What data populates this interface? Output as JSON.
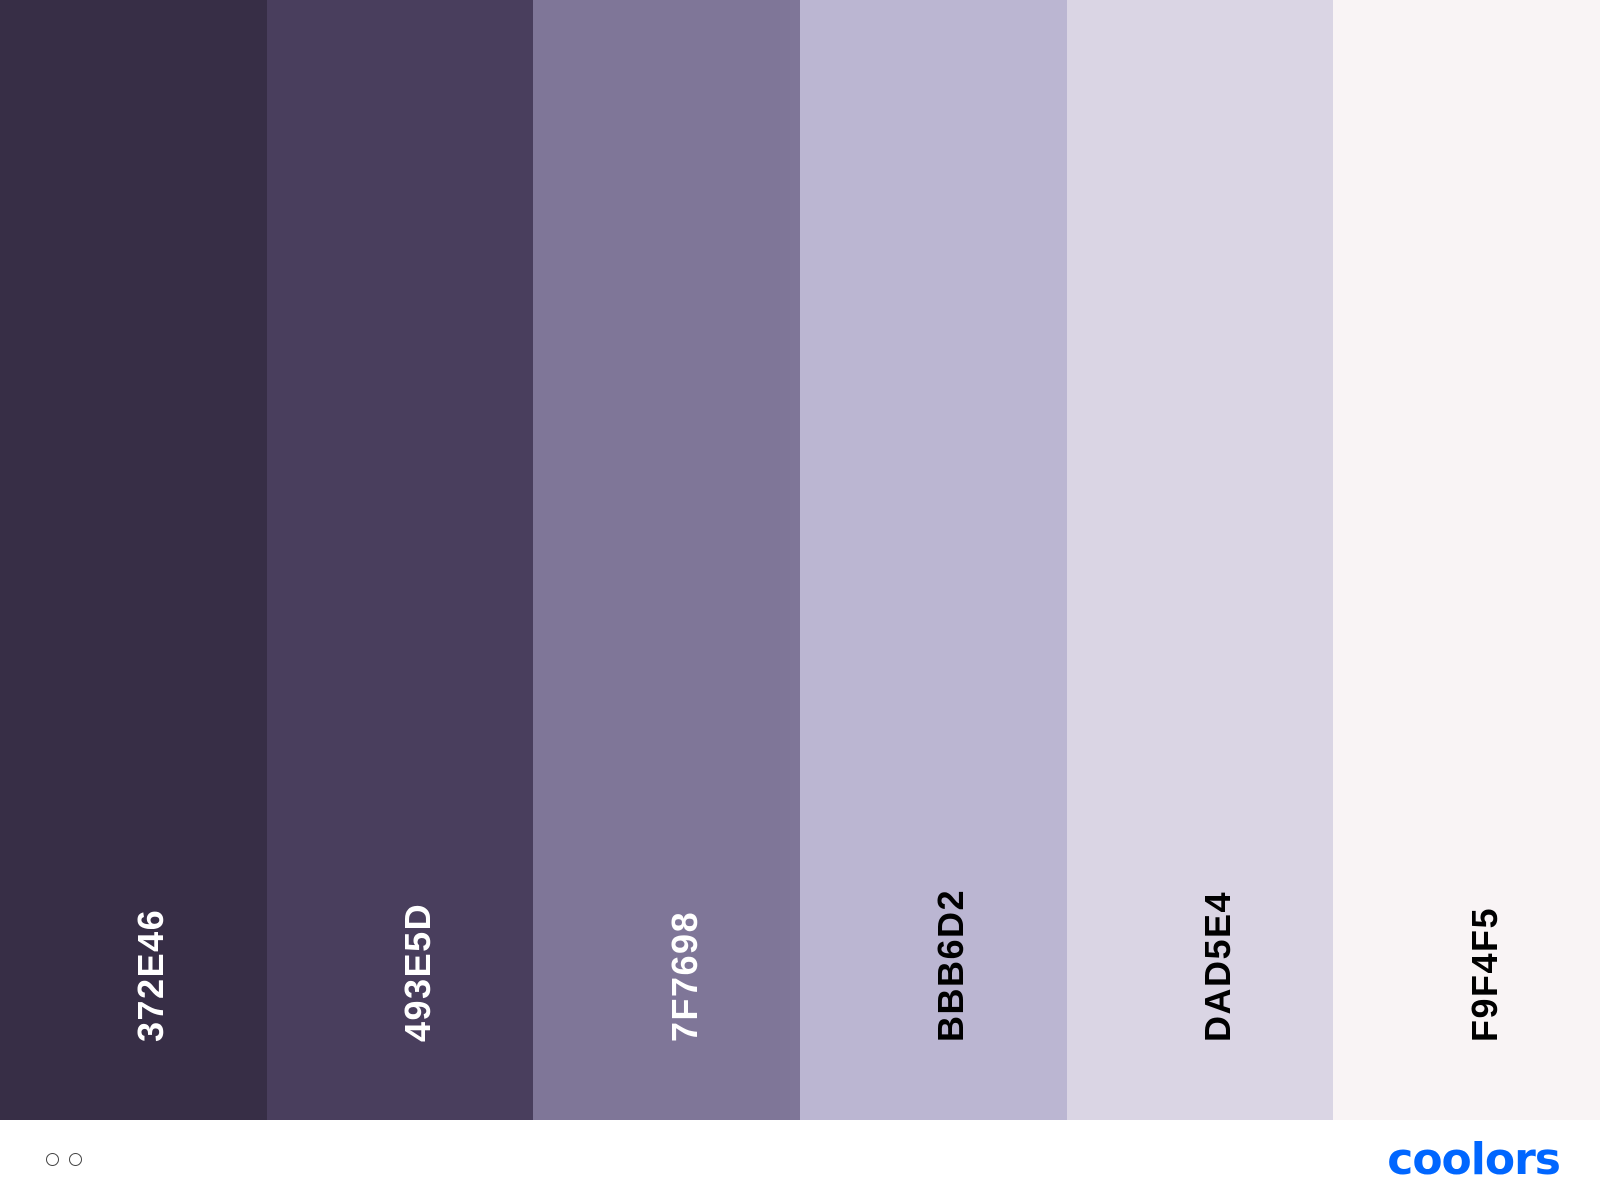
{
  "palette": {
    "swatches": [
      {
        "hex": "372E46",
        "color": "#372E46",
        "text_color": "#FFFFFF"
      },
      {
        "hex": "493E5D",
        "color": "#493E5D",
        "text_color": "#FFFFFF"
      },
      {
        "hex": "7F7698",
        "color": "#7F7698",
        "text_color": "#FFFFFF"
      },
      {
        "hex": "BBB6D2",
        "color": "#BBB6D2",
        "text_color": "#000000"
      },
      {
        "hex": "DAD5E4",
        "color": "#DAD5E4",
        "text_color": "#000000"
      },
      {
        "hex": "F9F4F5",
        "color": "#F9F4F5",
        "text_color": "#000000"
      }
    ]
  },
  "footer": {
    "dots_icon": "two-circles-icon",
    "brand_name": "coolors",
    "brand_color": "#0066FF"
  }
}
